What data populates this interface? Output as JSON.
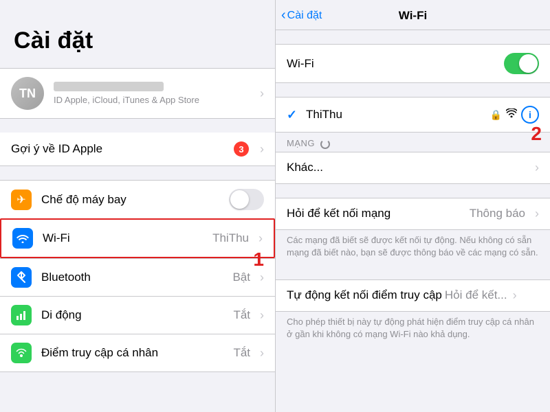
{
  "left": {
    "title": "Cài đặt",
    "avatar_initials": "TN",
    "account_subtitle": "ID Apple, iCloud, iTunes & App Store",
    "suggestion_label": "Gợi ý về ID Apple",
    "suggestion_badge": "3",
    "settings_rows": [
      {
        "id": "airplane",
        "icon": "✈",
        "icon_class": "icon-airplane",
        "label": "Chế độ máy bay",
        "value": "",
        "show_toggle": true,
        "toggle_on": false
      },
      {
        "id": "wifi",
        "icon": "wifi",
        "icon_class": "icon-wifi",
        "label": "Wi-Fi",
        "value": "ThiThu",
        "show_toggle": false,
        "highlighted": true
      },
      {
        "id": "bluetooth",
        "icon": "bluetooth",
        "icon_class": "icon-bluetooth",
        "label": "Bluetooth",
        "value": "Bật",
        "show_toggle": false
      },
      {
        "id": "cellular",
        "icon": "cellular",
        "icon_class": "icon-cellular",
        "label": "Di động",
        "value": "Tắt",
        "show_toggle": false
      },
      {
        "id": "hotspot",
        "icon": "hotspot",
        "icon_class": "icon-hotspot",
        "label": "Điểm truy cập cá nhân",
        "value": "Tắt",
        "show_toggle": false
      }
    ],
    "number_label": "1"
  },
  "right": {
    "back_label": "Cài đặt",
    "title": "Wi-Fi",
    "wifi_label": "Wi-Fi",
    "connected_network": "ThiThu",
    "mang_label": "MẠNG",
    "other_label": "Khác...",
    "ask_label": "Hỏi để kết nối mạng",
    "ask_value": "Thông báo",
    "ask_description": "Các mạng đã biết sẽ được kết nối tự động. Nếu không có sẵn mạng đã biết nào, bạn sẽ được thông báo về các mạng có sẵn.",
    "auto_label": "Tự động kết nối điểm truy cập",
    "auto_value": "Hỏi để kết...",
    "auto_description": "Cho phép thiết bị này tự động phát hiện điểm truy cập cá nhân ở gần khi không có mạng Wi-Fi nào khả dụng.",
    "number_label": "2"
  }
}
